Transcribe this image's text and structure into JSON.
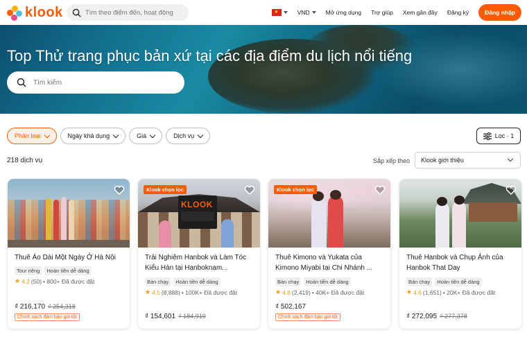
{
  "header": {
    "logo_text": "klook",
    "search_placeholder": "Tìm theo điểm đến, hoạt động",
    "currency": "VND",
    "nav": [
      "Mở ứng dụng",
      "Trợ giúp",
      "Xem gần đây",
      "Đăng ký"
    ],
    "login_label": "Đăng nhập"
  },
  "hero": {
    "title": "Top Thử trang phục bản xứ tại các địa điểm du lịch nổi tiếng",
    "search_placeholder": "Tìm kiếm"
  },
  "filters": {
    "chips": [
      "Phân loại",
      "Ngày khả dụng",
      "Giá",
      "Dịch vụ"
    ],
    "filter_button": "Lọc · 1"
  },
  "results": {
    "count": "218 dịch vụ",
    "sort_label": "Sắp xếp theo",
    "sort_value": "Klook giới thiệu"
  },
  "cards": [
    {
      "badge": "",
      "title": "Thuê Áo Dài Một Ngày Ở Hà Nội",
      "tags": [
        "Tour riêng",
        "Hoàn tiền dễ dàng"
      ],
      "score": "4.2",
      "reviews": "(50)",
      "booked": "• 800+ Đã được đặt",
      "price": "₫ 216,170",
      "old_price": "₫ 254,318",
      "guarantee": "Chính sách đảm bảo giá tốt"
    },
    {
      "badge": "Klook chọn lọc",
      "title": "Trải Nghiệm Hanbok và Làm Tóc Kiểu Hàn tại Hanboknam...",
      "tags": [
        "Bán chạy",
        "Hoàn tiền dễ dàng"
      ],
      "score": "4.5",
      "reviews": "(8,888)",
      "booked": "• 100K+ Đã được đặt",
      "price": "₫ 154,601",
      "old_price": "₫ 184,919",
      "guarantee": ""
    },
    {
      "badge": "Klook chọn lọc",
      "title": "Thuê Kimono và Yukata của Kimono Miyabi tại Chi Nhánh ...",
      "tags": [
        "Bán chạy",
        "Hoàn tiền dễ dàng"
      ],
      "score": "4.8",
      "reviews": "(2,419)",
      "booked": "• 40K+ Đã được đặt",
      "price": "₫ 502,167",
      "old_price": "",
      "guarantee": "Chính sách đảm bảo giá tốt"
    },
    {
      "badge": "",
      "title": "Thuê Hanbok và Chụp Ảnh của Hanbok That Day",
      "tags": [
        "Bán chạy",
        "Hoàn tiền dễ dàng"
      ],
      "score": "4.6",
      "reviews": "(1,651)",
      "booked": "• 20K+ Đã được đặt",
      "price": "₫ 272,095",
      "old_price": "₫ 277,378",
      "guarantee": ""
    }
  ],
  "card2_logo": "KLOOK",
  "colors": {
    "brand": "#ff5b00",
    "star": "#f09b0a"
  }
}
